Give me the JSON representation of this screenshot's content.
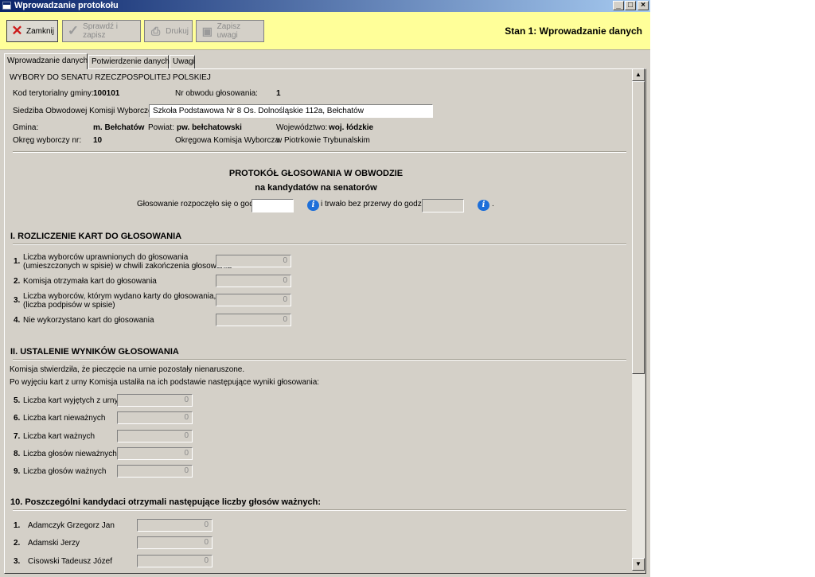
{
  "window": {
    "title": "Wprowadzanie protokołu",
    "controls": {
      "minimize": "_",
      "maximize": "□",
      "close": "×"
    }
  },
  "toolbar": {
    "close_label": "Zamknij",
    "verify_label": "Sprawdź i zapisz",
    "print_label": "Drukuj",
    "notes_label": "Zapisz uwagi",
    "state": "Stan 1: Wprowadzanie danych",
    "icons": {
      "close": "red-x-icon",
      "verify": "checkmark-icon",
      "print": "printer-icon",
      "notes": "floppy-disk-icon"
    }
  },
  "tabs": [
    "Wprowadzanie danych",
    "Potwierdzenie danych",
    "Uwagi"
  ],
  "header": {
    "election": "WYBORY DO SENATU RZECZPOSPOLITEJ POLSKIEJ",
    "territory_code_label": "Kod terytorialny gminy:",
    "territory_code": "100101",
    "district_no_label": "Nr obwodu głosowania:",
    "district_no": "1",
    "seat_label": "Siedziba Obwodowej Komisji Wyborczej:",
    "seat_value": "Szkoła Podstawowa Nr 8 Os. Dolnośląskie 112a, Bełchatów",
    "gmina_label": "Gmina:",
    "gmina": "m. Bełchatów",
    "powiat_label": "Powiat:",
    "powiat": "pw. bełchatowski",
    "woj_label": "Województwo:",
    "woj": "woj. łódzkie",
    "okreg_label": "Okręg wyborczy nr:",
    "okreg": "10",
    "commission_label": "Okręgowa Komisja Wyborcza",
    "commission": "w Piotrkowie Trybunalskim"
  },
  "protocol": {
    "title1": "PROTOKÓŁ GŁOSOWANIA W OBWODZIE",
    "title2": "na kandydatów na senatorów",
    "start_label": "Głosowanie rozpoczęło się o godz.",
    "start_value": "",
    "end_label": "i trwało bez przerwy do godz.",
    "end_value": "",
    "period": ".",
    "info_glyph": "i"
  },
  "section1": {
    "title": "I. ROZLICZENIE KART DO GŁOSOWANIA",
    "rows": [
      {
        "num": "1.",
        "line1": "Liczba wyborców uprawnionych do głosowania",
        "line2": "(umieszczonych w spisie) w chwili zakończenia głosowania",
        "value": "0"
      },
      {
        "num": "2.",
        "line1": "Komisja otrzymała kart do głosowania",
        "line2": "",
        "value": "0"
      },
      {
        "num": "3.",
        "line1": "Liczba wyborców, którym wydano karty do głosowania,",
        "line2": "(liczba podpisów w spisie)",
        "value": "0"
      },
      {
        "num": "4.",
        "line1": "Nie wykorzystano kart do głosowania",
        "line2": "",
        "value": "0"
      }
    ]
  },
  "section2": {
    "title": "II. USTALENIE WYNIKÓW GŁOSOWANIA",
    "note1": "Komisja stwierdziła, że pieczęcie na urnie pozostały nienaruszone.",
    "note2": "Po wyjęciu kart z urny Komisja ustaliła na ich podstawie następujące wyniki głosowania:",
    "rows": [
      {
        "num": "5.",
        "label": "Liczba kart wyjętych z urny",
        "value": "0"
      },
      {
        "num": "6.",
        "label": "Liczba kart nieważnych",
        "value": "0"
      },
      {
        "num": "7.",
        "label": "Liczba kart ważnych",
        "value": "0"
      },
      {
        "num": "8.",
        "label": "Liczba głosów nieważnych",
        "value": "0"
      },
      {
        "num": "9.",
        "label": "Liczba głosów ważnych",
        "value": "0"
      }
    ]
  },
  "section3": {
    "title": "10. Poszczególni kandydaci otrzymali następujące liczby głosów ważnych:",
    "candidates": [
      {
        "num": "1.",
        "name": "Adamczyk Grzegorz Jan",
        "value": "0"
      },
      {
        "num": "2.",
        "name": "Adamski Jerzy",
        "value": "0"
      },
      {
        "num": "3.",
        "name": "Cisowski Tadeusz Józef",
        "value": "0"
      }
    ]
  },
  "scrollbar": {
    "up": "▲",
    "down": "▼"
  }
}
